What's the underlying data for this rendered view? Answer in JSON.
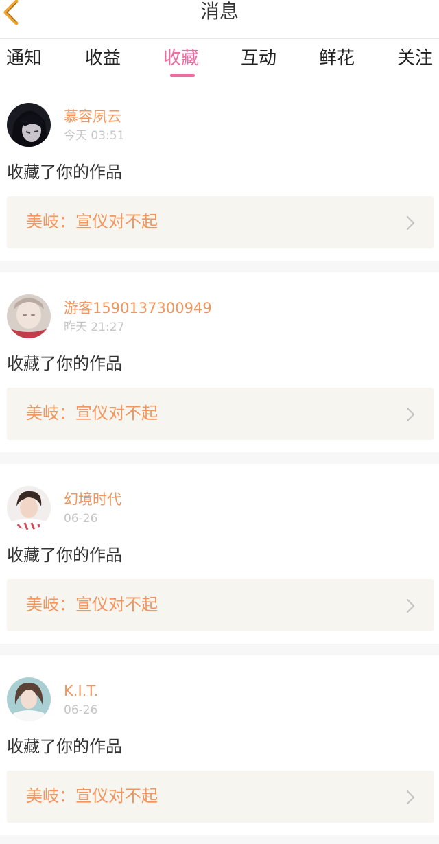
{
  "header": {
    "title": "消息",
    "back_icon": "chevron-left-icon",
    "back_color": "#f0a42a"
  },
  "tabs": [
    {
      "label": "通知",
      "active": false
    },
    {
      "label": "收益",
      "active": false
    },
    {
      "label": "收藏",
      "active": true
    },
    {
      "label": "互动",
      "active": false
    },
    {
      "label": "鲜花",
      "active": false
    },
    {
      "label": "关注",
      "active": false
    }
  ],
  "colors": {
    "accent": "#f06aa0",
    "username": "#f3955c",
    "work_box_bg": "#f6f5ef",
    "separator": "#f7f7f7"
  },
  "items": [
    {
      "username": "慕容夙云",
      "time": "今天 03:51",
      "action": "收藏了你的作品",
      "work_title": "美岐：宣仪对不起",
      "arrow_icon": "chevron-right-icon"
    },
    {
      "username": "游客1590137300949",
      "time": "昨天 21:27",
      "action": "收藏了你的作品",
      "work_title": "美岐：宣仪对不起",
      "arrow_icon": "chevron-right-icon"
    },
    {
      "username": "幻境时代",
      "time": "06-26",
      "action": "收藏了你的作品",
      "work_title": "美岐：宣仪对不起",
      "arrow_icon": "chevron-right-icon"
    },
    {
      "username": "K.I.T.",
      "time": "06-26",
      "action": "收藏了你的作品",
      "work_title": "美岐：宣仪对不起",
      "arrow_icon": "chevron-right-icon"
    }
  ]
}
